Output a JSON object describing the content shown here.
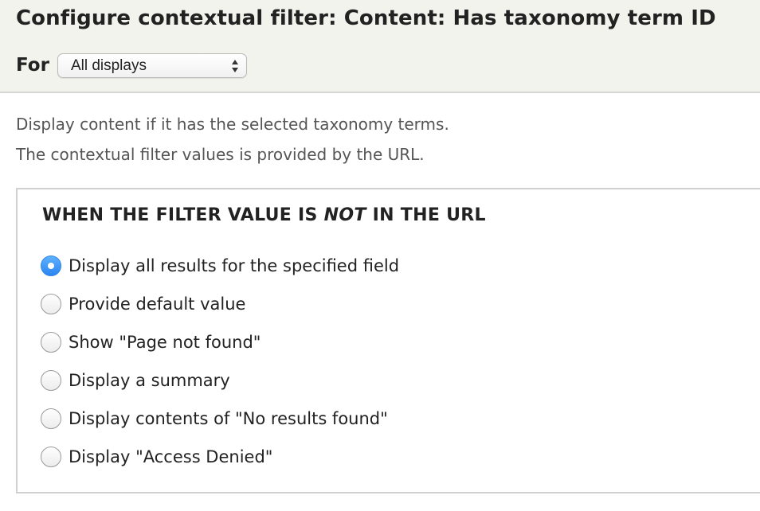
{
  "header": {
    "title": "Configure contextual filter: Content: Has taxonomy term ID",
    "for_label": "For",
    "for_select": {
      "selected": "All displays"
    }
  },
  "description": {
    "line1": "Display content if it has the selected taxonomy terms.",
    "line2": "The contextual filter values is provided by the URL."
  },
  "fieldset": {
    "legend_before": "WHEN THE FILTER VALUE IS ",
    "legend_emphasis": "NOT",
    "legend_after": " IN THE URL",
    "options": [
      {
        "label": "Display all results for the specified field",
        "checked": true
      },
      {
        "label": "Provide default value",
        "checked": false
      },
      {
        "label": "Show \"Page not found\"",
        "checked": false
      },
      {
        "label": "Display a summary",
        "checked": false
      },
      {
        "label": "Display contents of \"No results found\"",
        "checked": false
      },
      {
        "label": "Display \"Access Denied\"",
        "checked": false
      }
    ]
  },
  "colors": {
    "header_bg": "#f3f3ee",
    "accent_radio": "#2a86f0",
    "description_text": "#555555"
  }
}
